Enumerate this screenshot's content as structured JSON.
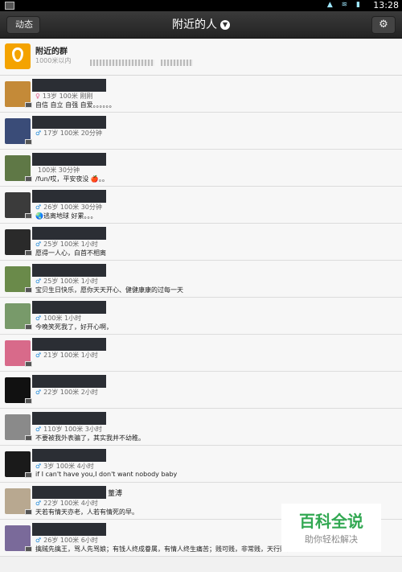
{
  "status": {
    "time": "13:28",
    "icons": "▲ ≋ ▮"
  },
  "topbar": {
    "back_label": "动态",
    "title": "附近的人",
    "title_chevron": "▼",
    "settings_icon": "⚙"
  },
  "group": {
    "name": "附近的群",
    "subtitle": "1000米以内"
  },
  "rows": [
    {
      "gender": "♀",
      "gender_type": "female",
      "meta": "13岁  100米 刚刚",
      "sig": "自信 自立 自强 自爱。。。。。。",
      "avatar_color": "#c48a38"
    },
    {
      "gender": "♂",
      "gender_type": "male",
      "meta": "17岁  100米 20分钟",
      "sig": "",
      "avatar_color": "#3a4c78"
    },
    {
      "gender": "",
      "gender_type": "none",
      "meta": "100米 30分钟",
      "sig": "/fun/哎，平安夜没 🍎。。",
      "avatar_color": "#5f7846"
    },
    {
      "gender": "♂",
      "gender_type": "male",
      "meta": "26岁  100米 30分钟",
      "sig": "🌏逃离地球    好累。。。",
      "avatar_color": "#3b3b3b"
    },
    {
      "gender": "♂",
      "gender_type": "male",
      "meta": "25岁  100米 1小时",
      "sig": "愿得一人心，白首不相离",
      "avatar_color": "#2a2a2a"
    },
    {
      "gender": "♂",
      "gender_type": "male",
      "meta": "25岁  100米 1小时",
      "sig": "宝贝生日快乐，愿你天天开心、健健康康的过每一天",
      "avatar_color": "#6a8a4a"
    },
    {
      "gender": "♂",
      "gender_type": "male",
      "meta": "100米 1小时",
      "sig": "今晚笑死我了，好开心啊，",
      "avatar_color": "#789a6a"
    },
    {
      "gender": "♂",
      "gender_type": "male",
      "meta": "21岁  100米 1小时",
      "sig": "",
      "avatar_color": "#d86a8a"
    },
    {
      "gender": "♂",
      "gender_type": "male",
      "meta": "22岁  100米 2小时",
      "sig": "",
      "avatar_color": "#111111"
    },
    {
      "gender": "♂",
      "gender_type": "male",
      "meta": "110岁  100米 3小时",
      "sig": "不要被我外表骗了，其实我并不幼稚。",
      "avatar_color": "#8a8a8a"
    },
    {
      "gender": "♂",
      "gender_type": "male",
      "meta": "3岁  100米 4小时",
      "sig": "if I can't have you,I don't want nobody baby",
      "avatar_color": "#1a1a1a"
    },
    {
      "gender": "♂",
      "gender_type": "male",
      "meta": "22岁  100米 4小时",
      "sig": "天若有情天亦老，人若有情死的早。",
      "avatar_color": "#b8a890",
      "extra": "蕫溥"
    },
    {
      "gender": "♂",
      "gender_type": "male",
      "meta": "26岁  100米 6小时",
      "sig": "擒贼先擒王，骂人先骂娘；有钱人终成眷属，有情人终生痛苦；贱可贱，非常贱，天行贱，君子以",
      "avatar_color": "#7a6a9a"
    }
  ],
  "watermark": {
    "line1": "百科全说",
    "line2": "助你轻松解决"
  }
}
